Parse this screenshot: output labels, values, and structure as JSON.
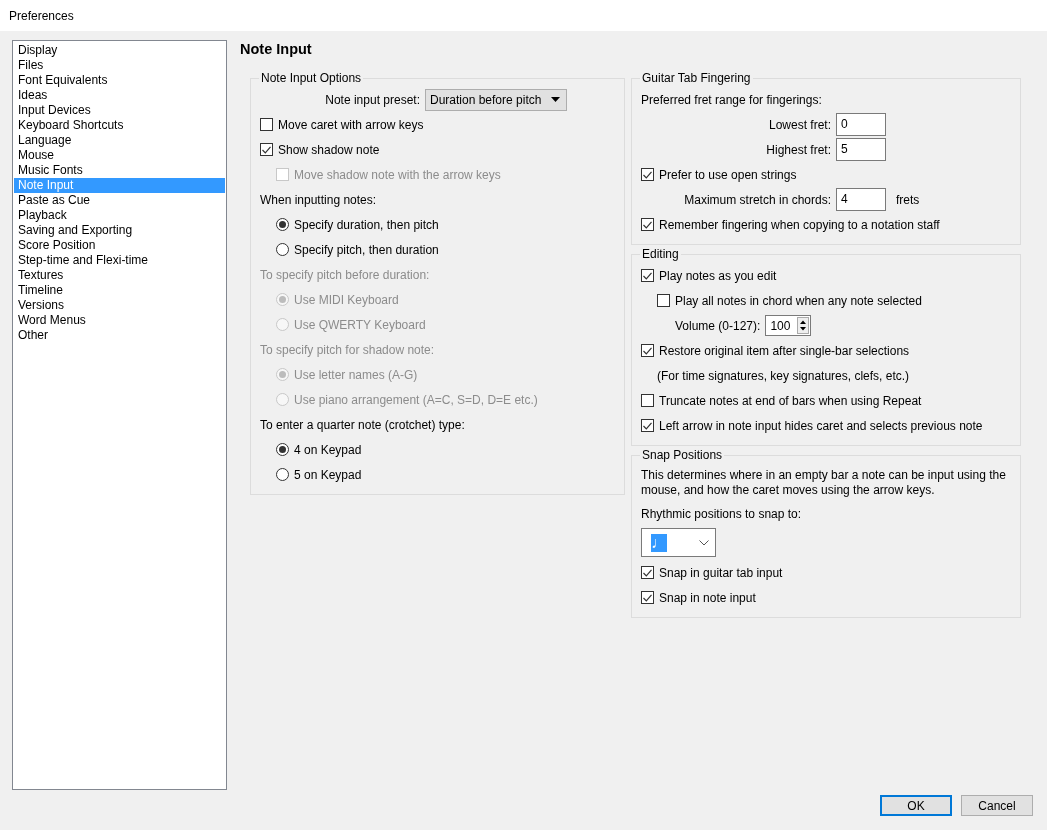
{
  "window": {
    "title": "Preferences"
  },
  "sidebar": {
    "items": [
      {
        "label": "Display",
        "selected": false
      },
      {
        "label": "Files",
        "selected": false
      },
      {
        "label": "Font Equivalents",
        "selected": false
      },
      {
        "label": "Ideas",
        "selected": false
      },
      {
        "label": "Input Devices",
        "selected": false
      },
      {
        "label": "Keyboard Shortcuts",
        "selected": false
      },
      {
        "label": "Language",
        "selected": false
      },
      {
        "label": "Mouse",
        "selected": false
      },
      {
        "label": "Music Fonts",
        "selected": false
      },
      {
        "label": "Note Input",
        "selected": true
      },
      {
        "label": "Paste as Cue",
        "selected": false
      },
      {
        "label": "Playback",
        "selected": false
      },
      {
        "label": "Saving and Exporting",
        "selected": false
      },
      {
        "label": "Score Position",
        "selected": false
      },
      {
        "label": "Step-time and Flexi-time",
        "selected": false
      },
      {
        "label": "Textures",
        "selected": false
      },
      {
        "label": "Timeline",
        "selected": false
      },
      {
        "label": "Versions",
        "selected": false
      },
      {
        "label": "Word Menus",
        "selected": false
      },
      {
        "label": "Other",
        "selected": false
      }
    ]
  },
  "page_title": "Note Input",
  "columns": [
    {
      "groups": [
        {
          "title": "Note Input Options",
          "items": [
            {
              "kind": "dropdown",
              "label": "Note input preset:",
              "value": "Duration before pitch"
            },
            {
              "kind": "checkbox",
              "label": "Move caret with arrow keys",
              "checked": false,
              "disabled": false
            },
            {
              "kind": "checkbox",
              "label": "Show shadow note",
              "checked": true,
              "disabled": false,
              "children": [
                {
                  "kind": "checkbox",
                  "label": "Move shadow note with the arrow keys",
                  "checked": false,
                  "disabled": true
                }
              ]
            },
            {
              "kind": "label",
              "label": "When inputting notes:",
              "disabled": false,
              "children": [
                {
                  "kind": "radio",
                  "label": "Specify duration, then pitch",
                  "selected": true,
                  "disabled": false
                },
                {
                  "kind": "radio",
                  "label": "Specify pitch, then duration",
                  "selected": false,
                  "disabled": false
                }
              ]
            },
            {
              "kind": "label",
              "label": "To specify pitch before duration:",
              "disabled": true,
              "children": [
                {
                  "kind": "radio",
                  "label": "Use MIDI Keyboard",
                  "selected": true,
                  "disabled": true
                },
                {
                  "kind": "radio",
                  "label": "Use QWERTY Keyboard",
                  "selected": false,
                  "disabled": true
                }
              ]
            },
            {
              "kind": "label",
              "label": "To specify pitch for shadow note:",
              "disabled": true,
              "children": [
                {
                  "kind": "radio",
                  "label": "Use letter names (A-G)",
                  "selected": true,
                  "disabled": true
                },
                {
                  "kind": "radio",
                  "label": "Use piano arrangement (A=C, S=D, D=E etc.)",
                  "selected": false,
                  "disabled": true
                }
              ]
            },
            {
              "kind": "label",
              "label": "To enter a quarter note (crotchet) type:",
              "disabled": false,
              "children": [
                {
                  "kind": "radio",
                  "label": "4 on Keypad",
                  "selected": true,
                  "disabled": false
                },
                {
                  "kind": "radio",
                  "label": "5 on Keypad",
                  "selected": false,
                  "disabled": false
                }
              ]
            }
          ]
        }
      ]
    },
    {
      "groups": [
        {
          "title": "Guitar Tab Fingering",
          "items": [
            {
              "kind": "label",
              "label": "Preferred fret range for fingerings:",
              "disabled": false
            },
            {
              "kind": "field",
              "label": "Lowest fret:",
              "value": "0"
            },
            {
              "kind": "field",
              "label": "Highest fret:",
              "value": "5"
            },
            {
              "kind": "checkbox",
              "label": "Prefer to use open strings",
              "checked": true,
              "disabled": false
            },
            {
              "kind": "field",
              "label": "Maximum stretch in chords:",
              "value": "4",
              "unit": "frets"
            },
            {
              "kind": "checkbox",
              "label": "Remember fingering when copying to a notation staff",
              "checked": true,
              "disabled": false
            }
          ]
        },
        {
          "title": "Editing",
          "items": [
            {
              "kind": "checkbox",
              "label": "Play notes as you edit",
              "checked": true,
              "disabled": false,
              "children": [
                {
                  "kind": "checkbox",
                  "label": "Play all notes in chord when any note selected",
                  "checked": false,
                  "disabled": false
                },
                {
                  "kind": "spin",
                  "label": "Volume (0-127):",
                  "value": "100"
                }
              ]
            },
            {
              "kind": "checkbox",
              "label": "Restore original item after single-bar selections",
              "checked": true,
              "disabled": false,
              "children": [
                {
                  "kind": "label",
                  "label": "(For time signatures, key signatures, clefs, etc.)",
                  "disabled": false
                }
              ]
            },
            {
              "kind": "checkbox",
              "label": "Truncate notes at end of bars when using Repeat",
              "checked": false,
              "disabled": false
            },
            {
              "kind": "checkbox",
              "label": "Left arrow in note input hides caret and selects previous note",
              "checked": true,
              "disabled": false
            }
          ]
        },
        {
          "title": "Snap Positions",
          "items": [
            {
              "kind": "paragraph",
              "label": "This determines where in an empty bar a note can be input using the mouse, and how the caret moves using the arrow keys."
            },
            {
              "kind": "label",
              "label": "Rhythmic positions to snap to:",
              "disabled": false
            },
            {
              "kind": "select",
              "value": "♩"
            },
            {
              "kind": "checkbox",
              "label": "Snap in guitar tab input",
              "checked": true,
              "disabled": false
            },
            {
              "kind": "checkbox",
              "label": "Snap in note input",
              "checked": true,
              "disabled": false
            }
          ]
        }
      ]
    }
  ],
  "buttons": [
    {
      "label": "OK",
      "default": true
    },
    {
      "label": "Cancel",
      "default": false
    }
  ]
}
